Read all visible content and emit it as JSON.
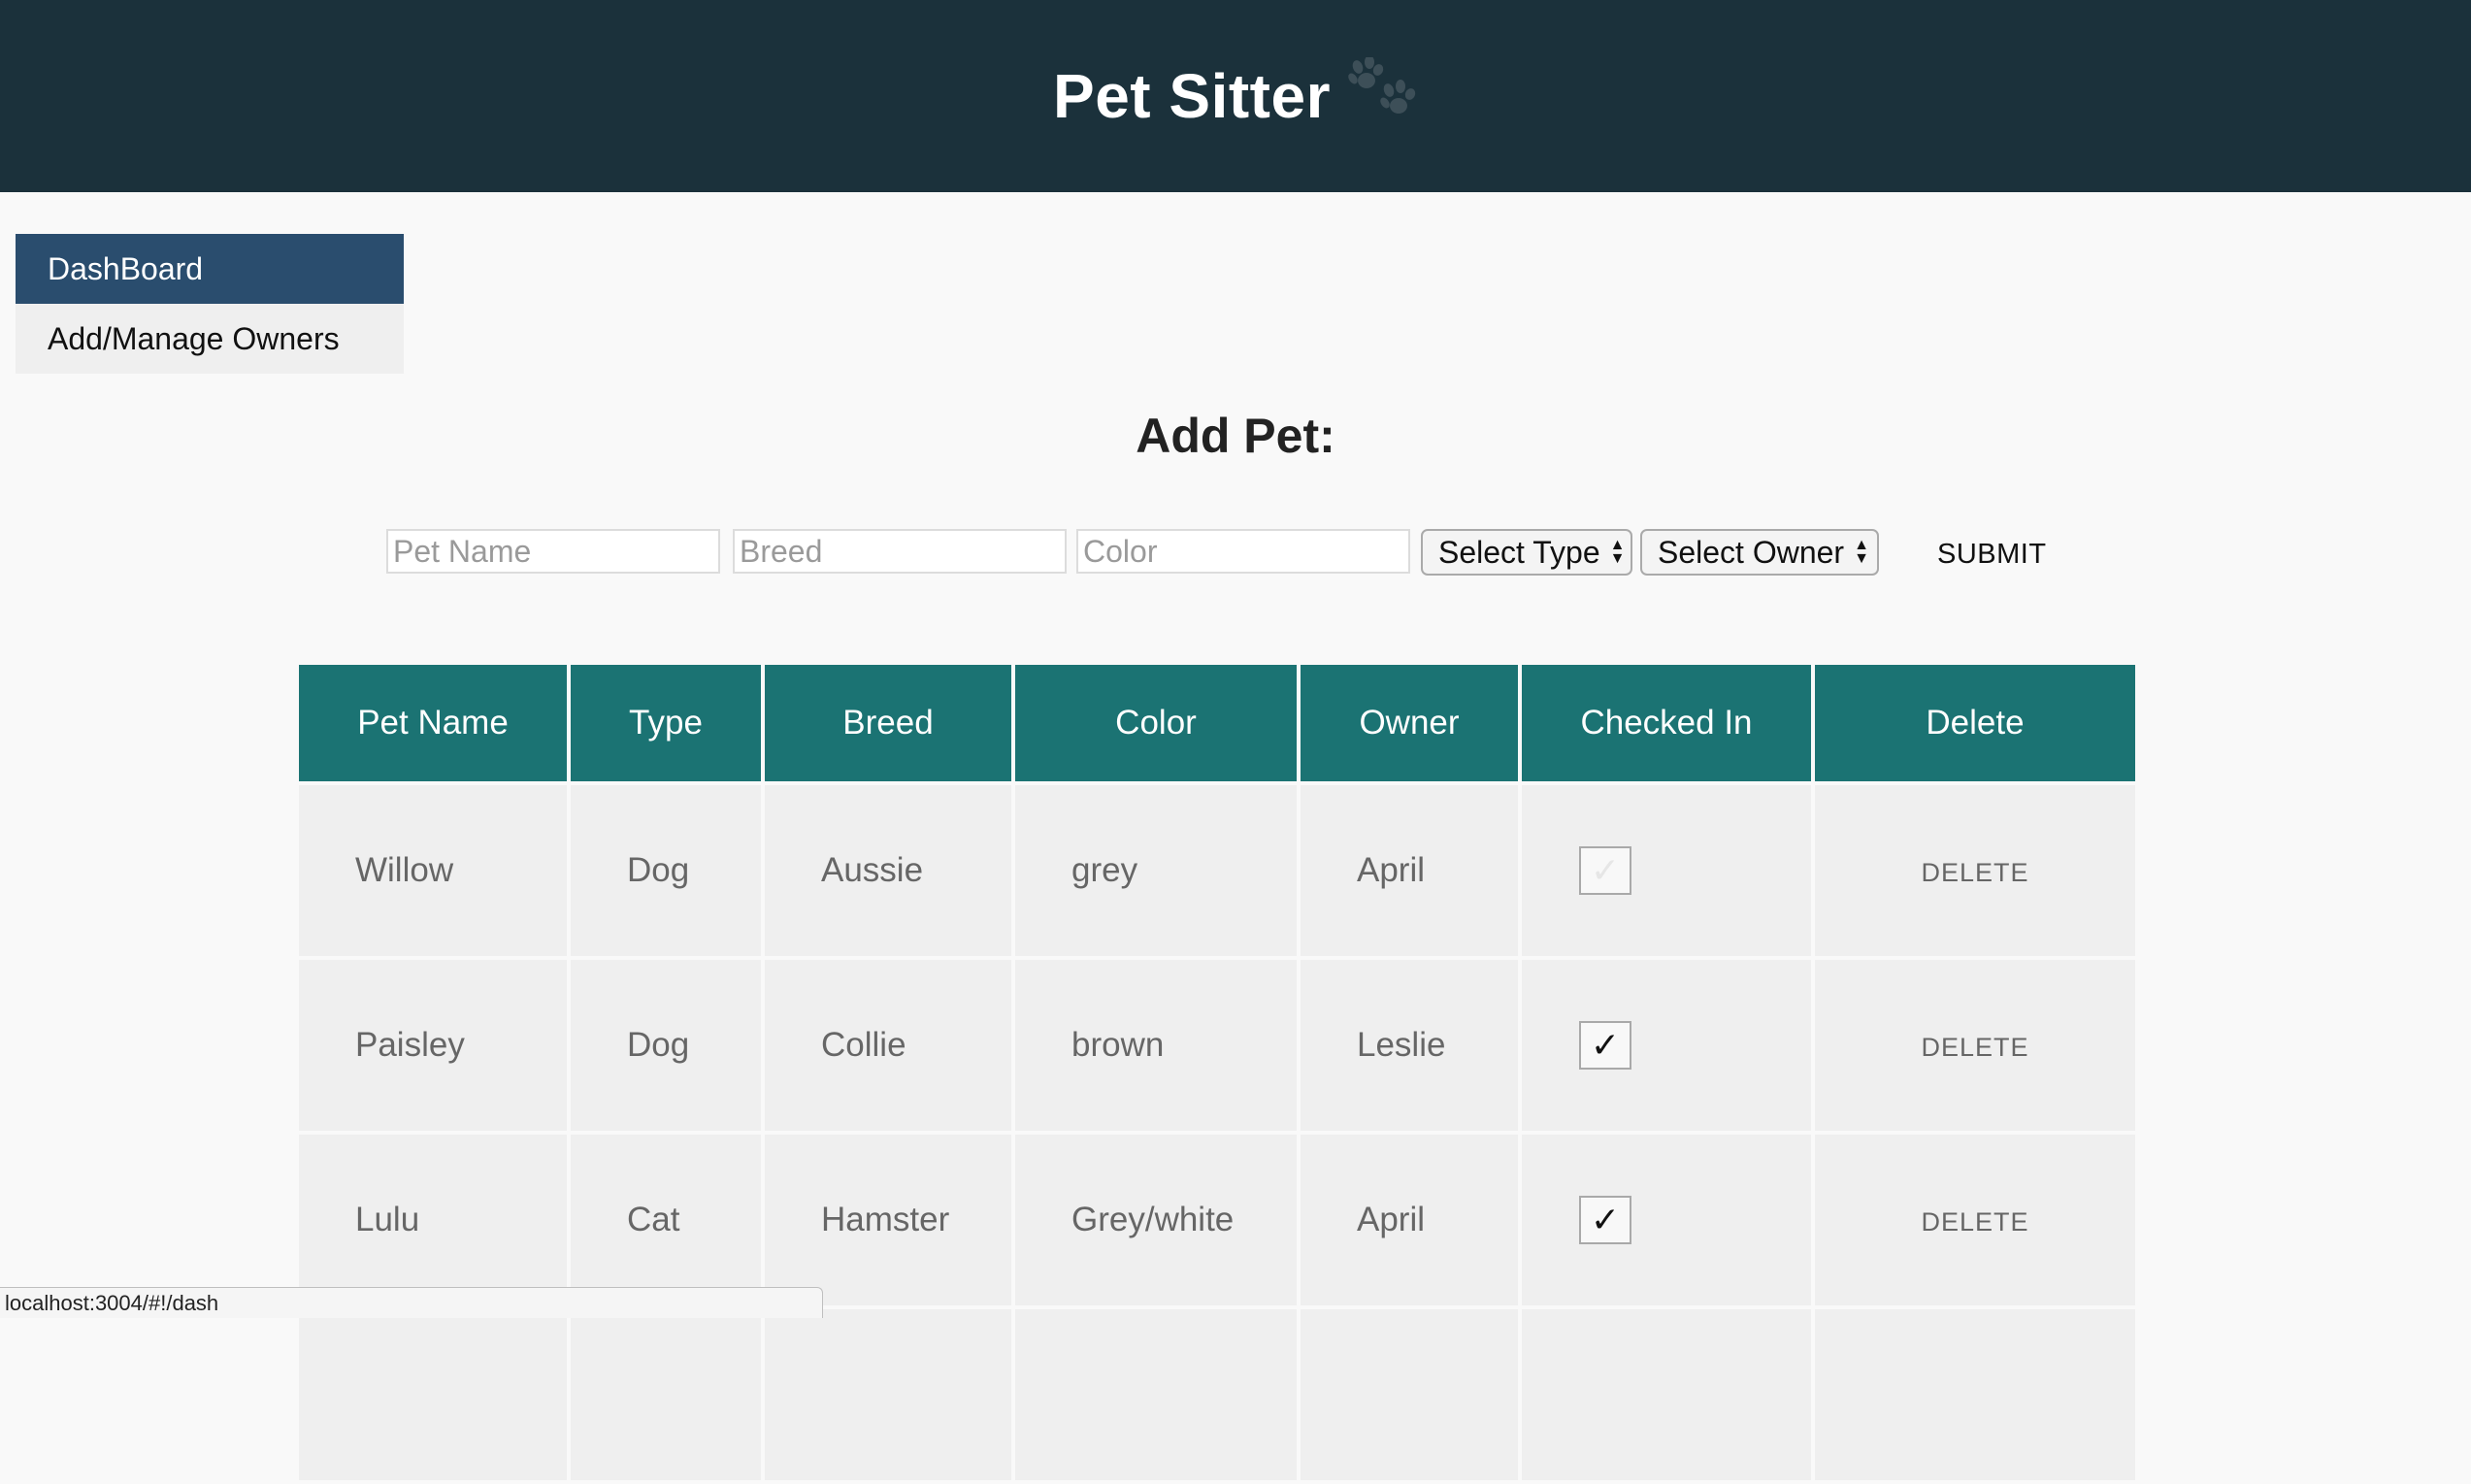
{
  "header": {
    "title": "Pet Sitter",
    "icon": "paw-prints-icon",
    "background": "#1b313b"
  },
  "sidebar": {
    "items": [
      {
        "label": "DashBoard",
        "active": true
      },
      {
        "label": "Add/Manage Owners",
        "active": false
      }
    ],
    "active_color": "#2a4d6e"
  },
  "form": {
    "title": "Add Pet:",
    "pet_name_placeholder": "Pet Name",
    "breed_placeholder": "Breed",
    "color_placeholder": "Color",
    "type_select": "Select Type",
    "owner_select": "Select Owner",
    "submit_label": "SUBMIT"
  },
  "table": {
    "header_color": "#1b7373",
    "columns": [
      "Pet Name",
      "Type",
      "Breed",
      "Color",
      "Owner",
      "Checked In",
      "Delete"
    ],
    "rows": [
      {
        "name": "Willow",
        "type": "Dog",
        "breed": "Aussie",
        "color": "grey",
        "owner": "April",
        "checked_in": false,
        "delete_label": "DELETE"
      },
      {
        "name": "Paisley",
        "type": "Dog",
        "breed": "Collie",
        "color": "brown",
        "owner": "Leslie",
        "checked_in": true,
        "delete_label": "DELETE"
      },
      {
        "name": "Lulu",
        "type": "Cat",
        "breed": "Hamster",
        "color": "Grey/white",
        "owner": "April",
        "checked_in": true,
        "delete_label": "DELETE"
      }
    ]
  },
  "status_bar": {
    "url": "localhost:3004/#!/dash"
  }
}
